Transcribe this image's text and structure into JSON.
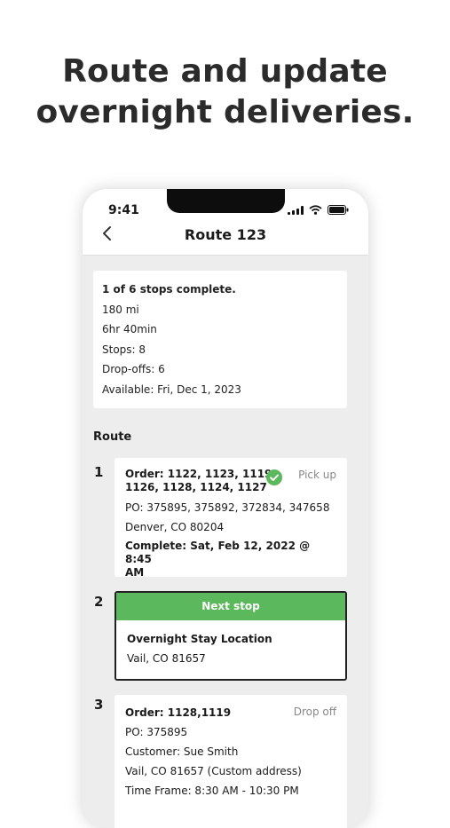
{
  "headline": {
    "line1": "Route and update",
    "line2": "overnight deliveries."
  },
  "status_bar": {
    "time": "9:41"
  },
  "nav": {
    "title": "Route 123"
  },
  "summary": {
    "progress": "1 of 6 stops complete.",
    "distance": "180 mi",
    "duration": "6hr 40min",
    "stops": "Stops: 8",
    "dropoffs": "Drop-offs: 6",
    "available": "Available: Fri, Dec 1, 2023"
  },
  "route_label": "Route",
  "stops": [
    {
      "number": "1",
      "orders_line1": "Order: 1122, 1123, 1119,",
      "orders_line2": "1126, 1128, 1124, 1127",
      "type": "Pick up",
      "po": "PO: 375895, 375892, 372834, 347658",
      "location": "Denver, CO 80204",
      "complete_line1": "Complete: Sat, Feb 12, 2022 @ 8:45",
      "complete_line2": "AM"
    },
    {
      "number": "2",
      "banner": "Next stop",
      "name": "Overnight Stay Location",
      "location": "Vail, CO 81657"
    },
    {
      "number": "3",
      "orders": "Order: 1128,1119",
      "type": "Drop off",
      "po": "PO: 375895",
      "customer": "Customer: Sue Smith",
      "address": "Vail, CO 81657 (Custom address)",
      "time_frame": "Time Frame: 8:30 AM - 10:30 PM"
    }
  ],
  "colors": {
    "accent_green": "#5cb85c",
    "background": "#ededed"
  }
}
